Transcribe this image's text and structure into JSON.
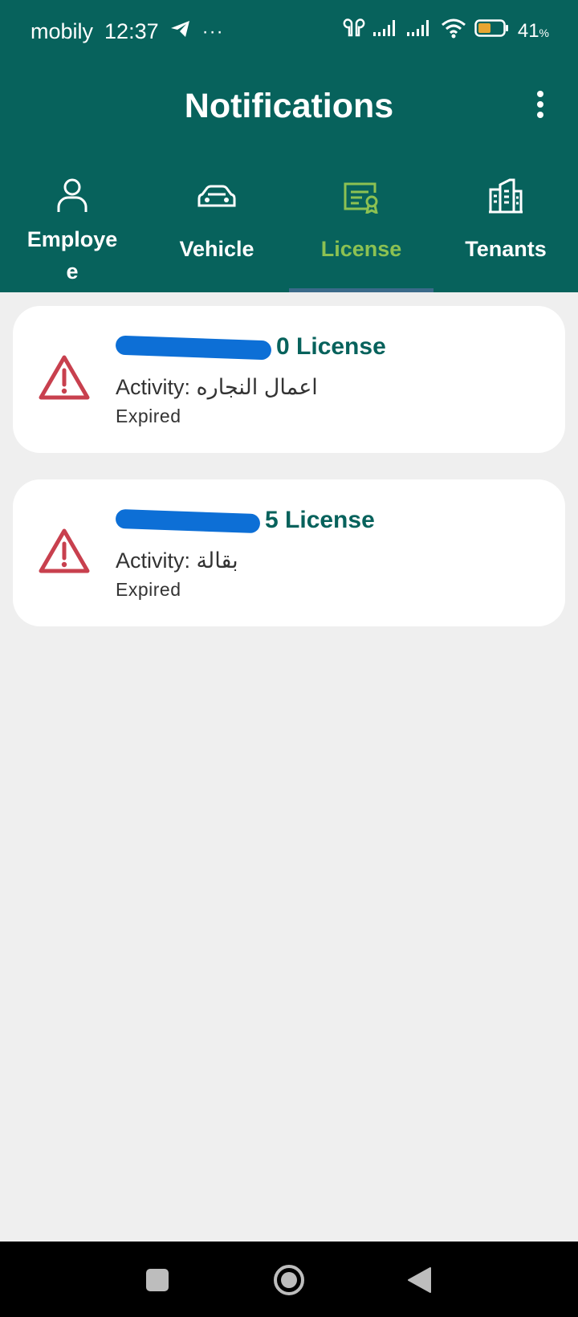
{
  "status_bar": {
    "carrier": "mobily",
    "time": "12:37",
    "extra": "···",
    "battery_percent": "41",
    "battery_unit": "%",
    "icons": [
      "telegram-icon",
      "earbuds-icon",
      "signal-icon",
      "signal-icon",
      "wifi-icon",
      "battery-icon"
    ]
  },
  "header": {
    "title": "Notifications",
    "menu_icon": "more-vertical-icon"
  },
  "tabs": [
    {
      "label": "Employe\ne",
      "icon": "person-icon",
      "active": false
    },
    {
      "label": "Vehicle",
      "icon": "car-icon",
      "active": false
    },
    {
      "label": "License",
      "icon": "license-certificate-icon",
      "active": true
    },
    {
      "label": "Tenants",
      "icon": "buildings-icon",
      "active": false
    }
  ],
  "notifications": [
    {
      "id_suffix": "0",
      "title_suffix": "License",
      "activity_label": "Activity:",
      "activity_value": "اعمال النجاره",
      "status": "Expired",
      "icon": "warning-triangle-icon"
    },
    {
      "id_suffix": "5",
      "title_suffix": "License",
      "activity_label": "Activity:",
      "activity_value": "بقالة",
      "status": "Expired",
      "icon": "warning-triangle-icon"
    }
  ],
  "colors": {
    "primary": "#07625c",
    "active_tab": "#8cc152",
    "warning": "#c8404e",
    "background": "#efefef"
  },
  "nav": [
    "recents-square-icon",
    "home-circle-icon",
    "back-triangle-icon"
  ]
}
